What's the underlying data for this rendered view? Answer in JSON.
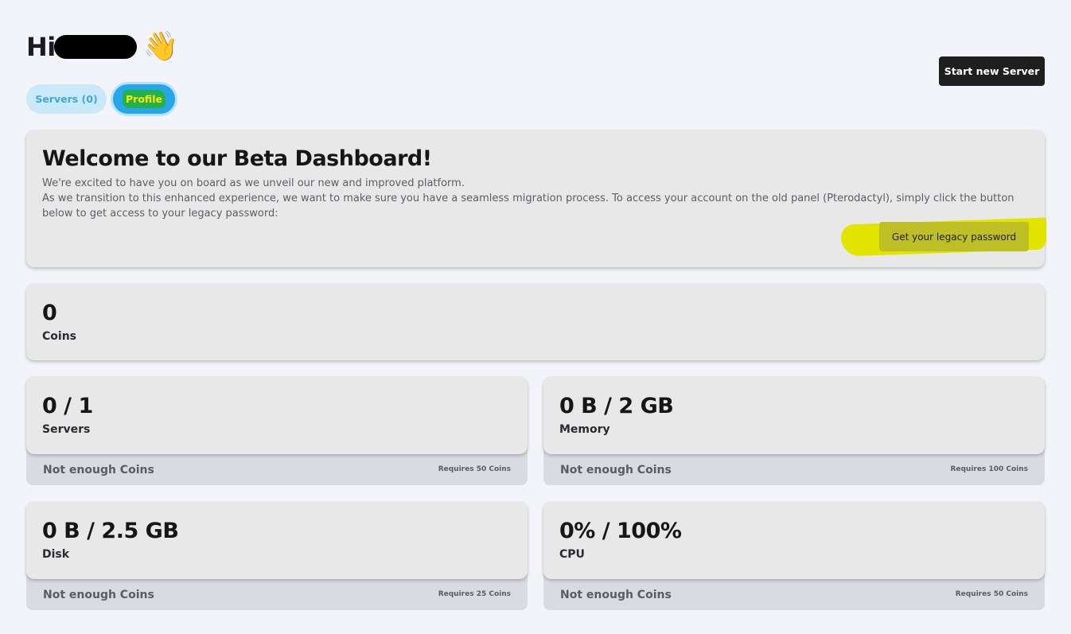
{
  "header": {
    "greeting": "Hi",
    "wave_emoji": "👋",
    "start_button": "Start new Server"
  },
  "tabs": [
    {
      "label": "Servers (0)"
    },
    {
      "label": "Profile"
    }
  ],
  "welcome": {
    "title": "Welcome to our Beta Dashboard!",
    "line1": "We're excited to have you on board as we unveil our new and improved platform.",
    "line2": "As we transition to this enhanced experience, we want to make sure you have a seamless migration process. To access your account on the old panel (Pterodactyl), simply click the button below to get access to your legacy password:",
    "button": "Get your legacy password"
  },
  "coins": {
    "value": "0",
    "label": "Coins"
  },
  "resources": [
    {
      "value": "0 / 1",
      "label": "Servers",
      "status": "Not enough Coins",
      "requirement": "Requires 50 Coins"
    },
    {
      "value": "0 B / 2 GB",
      "label": "Memory",
      "status": "Not enough Coins",
      "requirement": "Requires 100 Coins"
    },
    {
      "value": "0 B / 2.5 GB",
      "label": "Disk",
      "status": "Not enough Coins",
      "requirement": "Requires 25 Coins"
    },
    {
      "value": "0% / 100%",
      "label": "CPU",
      "status": "Not enough Coins",
      "requirement": "Requires 50 Coins"
    }
  ],
  "colors": {
    "background": "#f2f4f9",
    "primary_button": "#1f1f1f",
    "tab_active": "#27a6ea",
    "tab_inactive": "#c9e9f9",
    "card": "#e8e8e8",
    "highlight_annotation": "#e3e300"
  }
}
